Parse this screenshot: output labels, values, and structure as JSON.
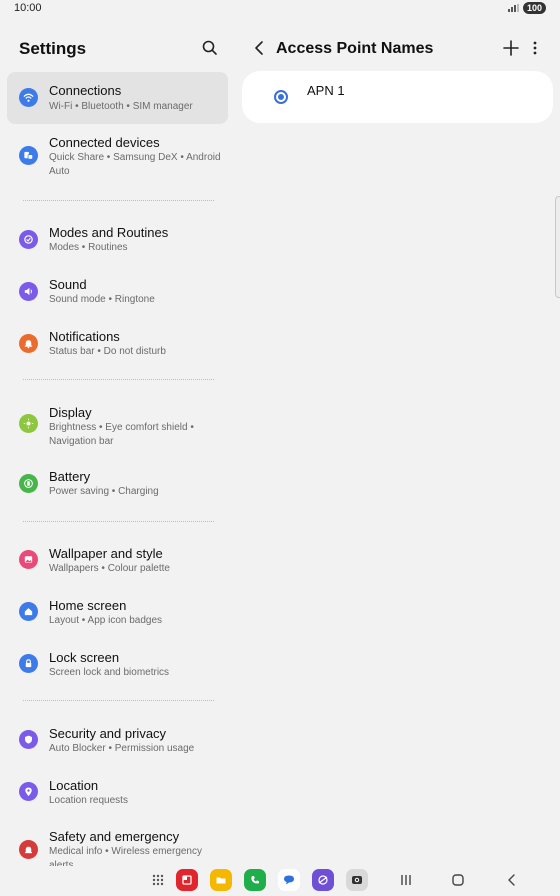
{
  "status": {
    "time": "10:00",
    "battery": "100"
  },
  "settings": {
    "title": "Settings",
    "items": [
      {
        "title": "Connections",
        "sub": "Wi-Fi  •  Bluetooth  •  SIM manager",
        "icon": "wifi-icon",
        "color": "#3d7be8"
      },
      {
        "title": "Connected devices",
        "sub": "Quick Share  •  Samsung DeX  •  Android Auto",
        "icon": "devices-icon",
        "color": "#3d7be8"
      },
      {
        "title": "Modes and Routines",
        "sub": "Modes  •  Routines",
        "icon": "modes-icon",
        "color": "#7a5ce8"
      },
      {
        "title": "Sound",
        "sub": "Sound mode  •  Ringtone",
        "icon": "speaker-icon",
        "color": "#7a5ce8"
      },
      {
        "title": "Notifications",
        "sub": "Status bar  •  Do not disturb",
        "icon": "bell-icon",
        "color": "#ea6b2e"
      },
      {
        "title": "Display",
        "sub": "Brightness  •  Eye comfort shield  •  Navigation bar",
        "icon": "sun-icon",
        "color": "#8dc63f"
      },
      {
        "title": "Battery",
        "sub": "Power saving  •  Charging",
        "icon": "battery-icon",
        "color": "#47b54a"
      },
      {
        "title": "Wallpaper and style",
        "sub": "Wallpapers  •  Colour palette",
        "icon": "wallpaper-icon",
        "color": "#e84a7a"
      },
      {
        "title": "Home screen",
        "sub": "Layout  •  App icon badges",
        "icon": "home-icon",
        "color": "#3d7be8"
      },
      {
        "title": "Lock screen",
        "sub": "Screen lock and biometrics",
        "icon": "lock-icon",
        "color": "#3d7be8"
      },
      {
        "title": "Security and privacy",
        "sub": "Auto Blocker  •  Permission usage",
        "icon": "shield-icon",
        "color": "#7a5ce8"
      },
      {
        "title": "Location",
        "sub": "Location requests",
        "icon": "location-icon",
        "color": "#7a5ce8"
      },
      {
        "title": "Safety and emergency",
        "sub": "Medical info  •  Wireless emergency alerts",
        "icon": "emergency-icon",
        "color": "#d63b3b"
      }
    ]
  },
  "apn": {
    "title": "Access Point Names",
    "entries": [
      {
        "name": "APN 1",
        "selected": true
      }
    ]
  },
  "dock": {
    "apps": [
      {
        "name": "app-drawer-icon",
        "color": "#666666"
      },
      {
        "name": "flipboard-icon",
        "color": "#e0262c"
      },
      {
        "name": "files-icon",
        "color": "#f5b800"
      },
      {
        "name": "phone-icon",
        "color": "#1fae4a"
      },
      {
        "name": "messages-icon",
        "color": "#2f6fe0"
      },
      {
        "name": "internet-icon",
        "color": "#6e4fd6"
      },
      {
        "name": "camera-icon",
        "color": "#8a8a8a"
      }
    ]
  }
}
